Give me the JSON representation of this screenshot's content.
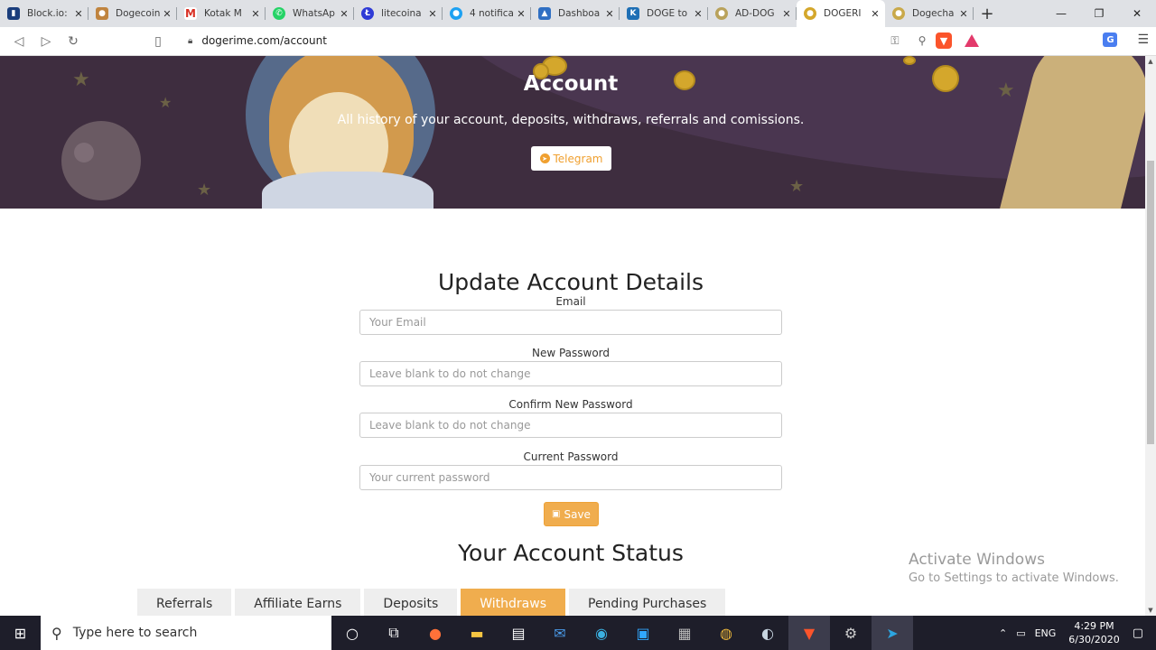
{
  "browser": {
    "tabs": [
      {
        "title": "Block.io:",
        "icon": "blockio-icon",
        "color": "#1a3d7c",
        "active": false
      },
      {
        "title": "Dogecoin",
        "icon": "doge-icon",
        "color": "#c0843f",
        "active": false
      },
      {
        "title": "Kotak M",
        "icon": "gmail-icon",
        "color": "#d93025",
        "active": false
      },
      {
        "title": "WhatsAp",
        "icon": "whatsapp-icon",
        "color": "#25d366",
        "active": false
      },
      {
        "title": "litecoina",
        "icon": "litecoin-icon",
        "color": "#2f3bd6",
        "active": false
      },
      {
        "title": "4 notifica",
        "icon": "notification-icon",
        "color": "#1da1f2",
        "active": false
      },
      {
        "title": "Dashboa",
        "icon": "dashboard-icon",
        "color": "#2f6fc3",
        "active": false
      },
      {
        "title": "DOGE to",
        "icon": "k-icon",
        "color": "#1e6fb5",
        "active": false
      },
      {
        "title": "AD-DOG",
        "icon": "coin-icon",
        "color": "#b9a25b",
        "active": false
      },
      {
        "title": "DOGERI",
        "icon": "coin-icon",
        "color": "#d4a72c",
        "active": true
      },
      {
        "title": "Dogecha",
        "icon": "coin-icon",
        "color": "#c9a94a",
        "active": false
      }
    ],
    "url": "dogerime.com/account"
  },
  "hero": {
    "title": "Account",
    "subtitle": "All history of your account, deposits, withdraws, referrals and comissions.",
    "telegram_label": "Telegram"
  },
  "form": {
    "heading": "Update Account Details",
    "email_label": "Email",
    "email_placeholder": "Your Email",
    "new_password_label": "New Password",
    "new_password_placeholder": "Leave blank to do not change",
    "confirm_password_label": "Confirm New Password",
    "confirm_password_placeholder": "Leave blank to do not change",
    "current_password_label": "Current Password",
    "current_password_placeholder": "Your current password",
    "save_label": "Save"
  },
  "status": {
    "heading": "Your Account Status",
    "tabs": [
      "Referrals",
      "Affiliate Earns",
      "Deposits",
      "Withdraws",
      "Pending Purchases"
    ],
    "active_tab": "Withdraws"
  },
  "watermark": {
    "line1": "Activate Windows",
    "line2": "Go to Settings to activate Windows."
  },
  "taskbar": {
    "search_placeholder": "Type here to search",
    "language": "ENG",
    "time": "4:29 PM",
    "date": "6/30/2020"
  },
  "colors": {
    "accent": "#f0ad4e",
    "hero_bg": "#3e2d3f"
  }
}
